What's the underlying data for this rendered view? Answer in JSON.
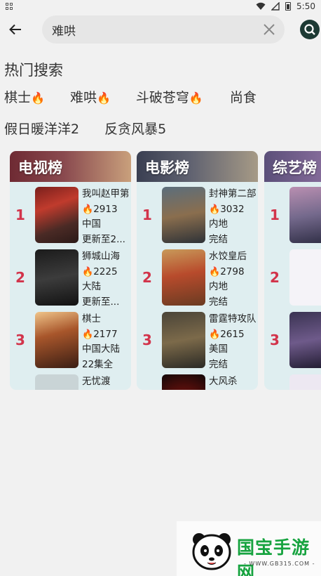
{
  "status_bar": {
    "time": "5:50"
  },
  "search": {
    "value": "难哄",
    "placeholder": ""
  },
  "hot_search": {
    "title": "热门搜索",
    "row1": [
      {
        "label": "棋士",
        "hot": true
      },
      {
        "label": "难哄",
        "hot": true
      },
      {
        "label": "斗破苍穹",
        "hot": true
      },
      {
        "label": "尚食",
        "hot": false
      }
    ],
    "row2": [
      {
        "label": "假日暖洋洋2"
      },
      {
        "label": "反贪风暴5"
      }
    ],
    "fire_glyph": "🔥"
  },
  "rank_cards": [
    {
      "title": "电视榜",
      "items": [
        {
          "rank": "1",
          "name": "我叫赵甲第",
          "heat": "2913",
          "region": "中国",
          "status": "更新至2..."
        },
        {
          "rank": "2",
          "name": "狮城山海",
          "heat": "2225",
          "region": "大陆",
          "status": "更新至..."
        },
        {
          "rank": "3",
          "name": "棋士",
          "heat": "2177",
          "region": "中国大陆",
          "status": "22集全"
        },
        {
          "rank": "",
          "name": "无忧渡",
          "heat": "",
          "region": "",
          "status": ""
        }
      ]
    },
    {
      "title": "电影榜",
      "items": [
        {
          "rank": "1",
          "name": "封神第二部",
          "heat": "3032",
          "region": "内地",
          "status": "完结"
        },
        {
          "rank": "2",
          "name": "水饺皇后",
          "heat": "2798",
          "region": "内地",
          "status": "完结"
        },
        {
          "rank": "3",
          "name": "雷霆特攻队",
          "heat": "2615",
          "region": "美国",
          "status": "完结"
        },
        {
          "rank": "",
          "name": "大风杀",
          "heat": "",
          "region": "",
          "status": ""
        }
      ]
    },
    {
      "title": "综艺榜",
      "items": [
        {
          "rank": "1",
          "name": "",
          "heat": "",
          "region": "",
          "status": ""
        },
        {
          "rank": "2",
          "name": "",
          "heat": "",
          "region": "",
          "status": ""
        },
        {
          "rank": "3",
          "name": "",
          "heat": "",
          "region": "",
          "status": ""
        },
        {
          "rank": "",
          "name": "",
          "heat": "",
          "region": "",
          "status": ""
        }
      ]
    }
  ],
  "watermark": {
    "brand": "国宝手游网",
    "url": "- WWW.GB315.COM -"
  },
  "colors": {
    "rank_number": "#d2344b",
    "search_button": "#1d3a34",
    "brand_green": "#16a33f"
  }
}
